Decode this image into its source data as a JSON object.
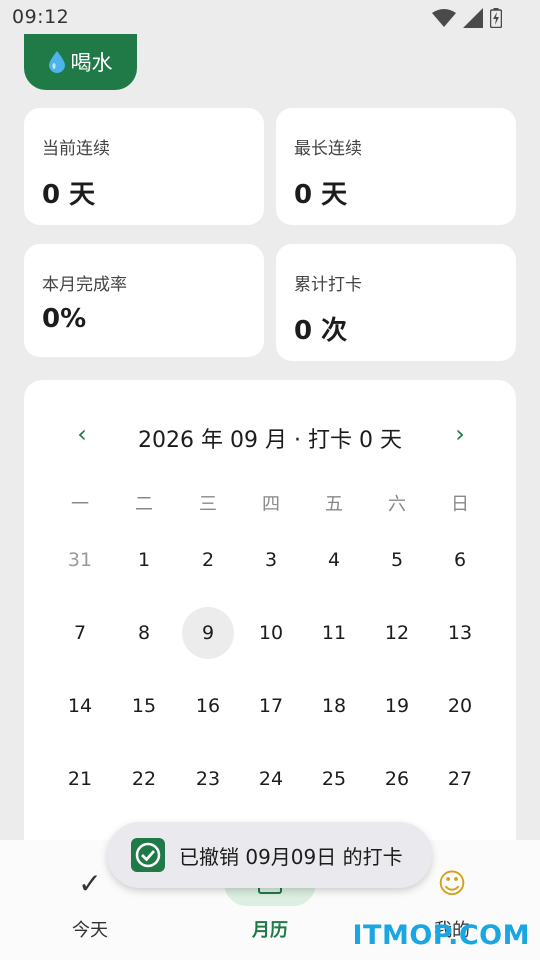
{
  "status_bar": {
    "time": "09:12"
  },
  "habit": {
    "icon": "water-drop-icon",
    "label": "喝水",
    "color": "#1f7a47"
  },
  "stats": {
    "current_streak": {
      "label": "当前连续",
      "value": "0 天"
    },
    "longest_streak": {
      "label": "最长连续",
      "value": "0 天"
    },
    "monthly_rate": {
      "label": "本月完成率",
      "value": "0%"
    },
    "total_checkins": {
      "label": "累计打卡",
      "value": "0 次"
    }
  },
  "calendar": {
    "prev": "‹",
    "next": "›",
    "title": "2026 年 09 月 · 打卡 0 天",
    "weekdays": [
      "一",
      "二",
      "三",
      "四",
      "五",
      "六",
      "日"
    ],
    "rows": [
      [
        "31",
        "1",
        "2",
        "3",
        "4",
        "5",
        "6"
      ],
      [
        "7",
        "8",
        "9",
        "10",
        "11",
        "12",
        "13"
      ],
      [
        "14",
        "15",
        "16",
        "17",
        "18",
        "19",
        "20"
      ],
      [
        "21",
        "22",
        "23",
        "24",
        "25",
        "26",
        "27"
      ]
    ],
    "today": "9"
  },
  "toast": {
    "text": "已撤销 09月09日 的打卡"
  },
  "nav": {
    "today": {
      "label": "今天",
      "icon": "checkmark-icon"
    },
    "calendar": {
      "label": "月历",
      "icon": "calendar-icon"
    },
    "me": {
      "label": "我的",
      "icon": "smile-icon"
    }
  },
  "watermark": "ITMOP.COM",
  "colors": {
    "accent": "#1f7a47",
    "background": "#ececec"
  }
}
